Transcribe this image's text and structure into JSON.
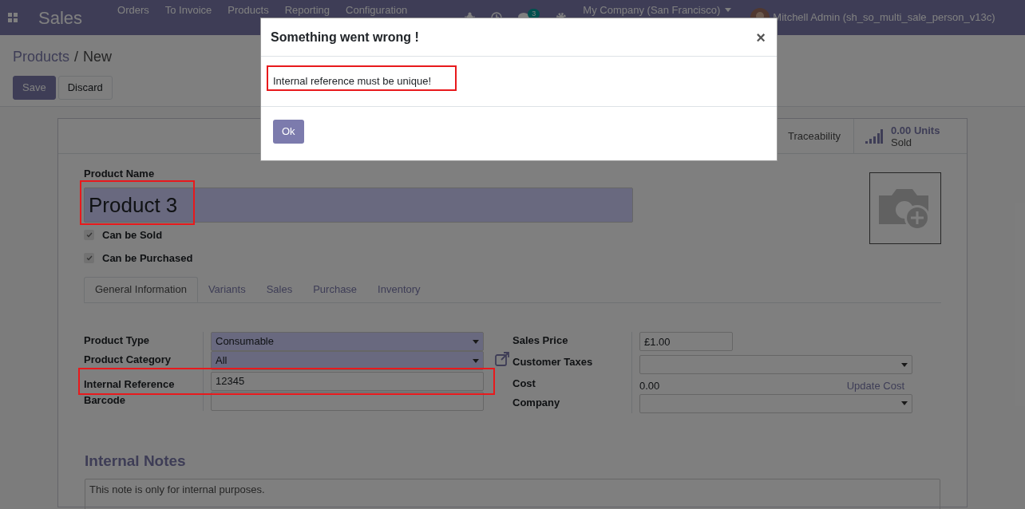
{
  "navbar": {
    "app_title": "Sales",
    "menu": [
      "Orders",
      "To Invoice",
      "Products",
      "Reporting",
      "Configuration"
    ],
    "messages_badge": "3",
    "company": "My Company (San Francisco)",
    "user": "Mitchell Admin (sh_so_multi_sale_person_v13c)"
  },
  "breadcrumb": [
    "Products",
    "New"
  ],
  "breadcrumb_separator": "/",
  "buttons": [
    "Save",
    "Discard"
  ],
  "stat_buttons": [
    {
      "kind": "text",
      "label": "Traceability"
    },
    {
      "kind": "stat",
      "value": "0.00 Units",
      "label": "Sold"
    }
  ],
  "product_name": {
    "label": "Product Name",
    "value": "Product 3",
    "required": true
  },
  "options": [
    {
      "label": "Can be Sold",
      "checked": true
    },
    {
      "label": "Can be Purchased",
      "checked": true
    }
  ],
  "tabs": [
    {
      "label": "General Information",
      "selected": true
    },
    {
      "label": "Variants",
      "selected": false
    },
    {
      "label": "Sales",
      "selected": false
    },
    {
      "label": "Purchase",
      "selected": false
    },
    {
      "label": "Inventory",
      "selected": false
    }
  ],
  "left_fields": [
    {
      "label": "Product Type",
      "kind": "select",
      "value": "Consumable",
      "required": true
    },
    {
      "label": "Product Category",
      "kind": "select",
      "value": "All",
      "required": true
    },
    {
      "label": "Internal Reference",
      "kind": "input",
      "value": "12345",
      "required": false
    },
    {
      "label": "Barcode",
      "kind": "input",
      "required": false
    }
  ],
  "right_fields": [
    {
      "label": "Sales Price",
      "kind": "input",
      "value": "£1.00"
    },
    {
      "label": "Customer Taxes",
      "kind": "select"
    },
    {
      "label": "Cost",
      "kind": "text",
      "value": "0.00",
      "action": "Update Cost"
    },
    {
      "label": "Company",
      "kind": "select"
    }
  ],
  "internal_notes": {
    "title": "Internal Notes",
    "placeholder": "This note is only for internal purposes."
  },
  "dialog": {
    "title": "Something went wrong !",
    "close": "×",
    "message": "Internal reference must be unique!",
    "button": "Ok"
  }
}
